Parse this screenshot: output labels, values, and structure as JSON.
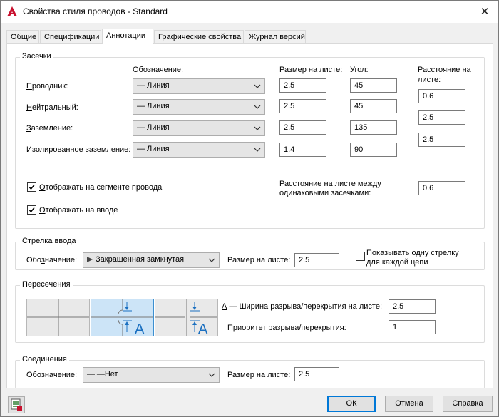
{
  "window": {
    "title": "Свойства стиля проводов - Standard",
    "close_glyph": "✕"
  },
  "tabs": [
    {
      "label": "Общие"
    },
    {
      "label": "Спецификации"
    },
    {
      "label": "Аннотации"
    },
    {
      "label": "Графические свойства"
    },
    {
      "label": "Журнал версий"
    }
  ],
  "ticks": {
    "title": "Засечки",
    "col_symbol": "Обозначение:",
    "col_size": "Размер на листе:",
    "col_angle": "Угол:",
    "col_distance_1": "Расстояние на",
    "col_distance_2": "листе:",
    "rows": [
      {
        "label_u": "П",
        "label_rest": "роводник:",
        "symbol": "— Линия",
        "size": "2.5",
        "angle": "45"
      },
      {
        "label_u": "Н",
        "label_rest": "ейтральный:",
        "symbol": "— Линия",
        "size": "2.5",
        "angle": "45"
      },
      {
        "label_u": "З",
        "label_rest": "аземление:",
        "symbol": "— Линия",
        "size": "2.5",
        "angle": "135"
      },
      {
        "label_u": "И",
        "label_rest": "золированное заземление:",
        "symbol": "— Линия",
        "size": "1.4",
        "angle": "90"
      }
    ],
    "distances": [
      "0.6",
      "2.5",
      "2.5"
    ],
    "show_on_segment": {
      "u": "О",
      "rest": "тображать на сегменте провода",
      "checked": true
    },
    "show_on_entry": {
      "u": "О",
      "rest": "тображать на вводе",
      "checked": true
    },
    "between_label_1": "Расстояние на листе между",
    "between_label_2": "одинаковыми засечками:",
    "between_value": "0.6"
  },
  "entry_arrow": {
    "title": "Стрелка ввода",
    "symbol_label_pre": "Обо",
    "symbol_label_u": "з",
    "symbol_label_post": "начение:",
    "symbol_value": "Закрашенная замкнутая",
    "size_label": "Размер на листе:",
    "size_value": "2.5",
    "single_arrow_1": "Показывать одну стрелку",
    "single_arrow_2": "для каждой цепи",
    "single_arrow_checked": false
  },
  "intersections": {
    "title": "Пересечения",
    "width_label_u": "А",
    "width_label_rest": " — Ширина разрыва/перекрытия на листе:",
    "width_value": "2.5",
    "priority_label": "Приоритет разрыва/перекрытия:",
    "priority_value": "1",
    "letter": "A",
    "selected_tile": 1
  },
  "connections": {
    "title": "Соединения",
    "symbol_label": "Обозначение:",
    "symbol_value": "—|—Нет",
    "size_label": "Размер на листе:",
    "size_value": "2.5"
  },
  "footer": {
    "ok": "ОК",
    "cancel": "Отмена",
    "help": "Справка"
  },
  "colors": {
    "accent": "#0078d7",
    "selected_tile": "#cce4f7",
    "autocad_red": "#c8102e"
  }
}
